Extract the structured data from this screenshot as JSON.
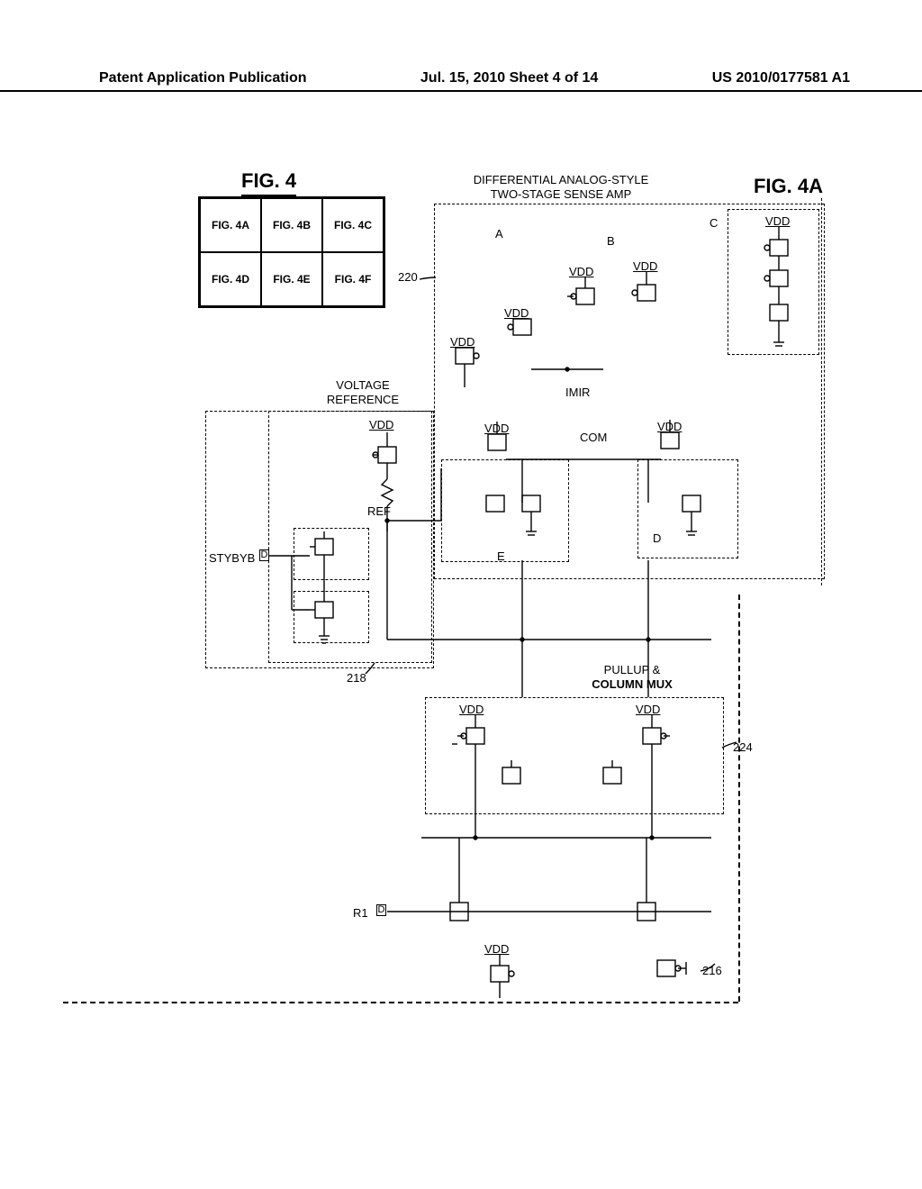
{
  "header": {
    "left": "Patent Application Publication",
    "center": "Jul. 15, 2010   Sheet 4 of 14",
    "right": "US 2010/0177581 A1"
  },
  "figTitle": "FIG. 4",
  "figGrid": [
    "FIG. 4A",
    "FIG. 4B",
    "FIG. 4C",
    "FIG. 4D",
    "FIG. 4E",
    "FIG. 4F"
  ],
  "figALabel": "FIG. 4A",
  "blockTitles": {
    "senseAmp1": "DIFFERENTIAL ANALOG-STYLE",
    "senseAmp2": "TWO-STAGE SENSE AMP",
    "voltageRef1": "VOLTAGE",
    "voltageRef2": "REFERENCE",
    "pullup1": "PULLUP &",
    "pullup2": "COLUMN MUX"
  },
  "nets": {
    "VDD": "VDD",
    "REF": "REF",
    "STYBYB": "STYBYB",
    "IMIR": "IMIR",
    "COM": "COM",
    "R1": "R1"
  },
  "refNums": {
    "r218": "218",
    "r220": "220",
    "r224": "224",
    "r216": "216"
  },
  "annot": {
    "A": "A",
    "B": "B",
    "C": "C",
    "D": "D",
    "E": "E"
  },
  "portBox": "D"
}
